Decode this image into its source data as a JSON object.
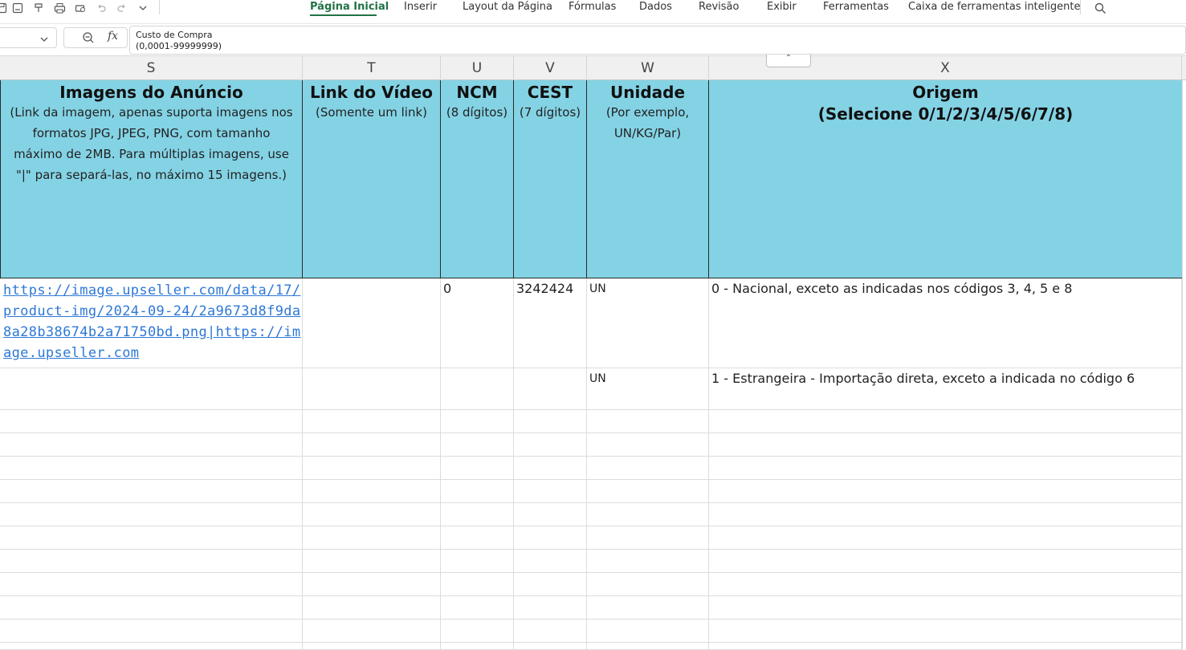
{
  "quick_access": {
    "icons": [
      "save-icon",
      "save-as-icon",
      "format-painter-icon",
      "print-icon",
      "print-preview-icon",
      "undo-icon",
      "redo-icon",
      "more-chevron-icon"
    ]
  },
  "menu": {
    "tabs": [
      {
        "label": "Página Inicial",
        "active": true
      },
      {
        "label": "Inserir"
      },
      {
        "label": "Layout da Página"
      },
      {
        "label": "Fórmulas"
      },
      {
        "label": "Dados"
      },
      {
        "label": "Revisão"
      },
      {
        "label": "Exibir"
      },
      {
        "label": "Ferramentas"
      },
      {
        "label": "Caixa de ferramentas inteligente"
      }
    ],
    "search_icon": "search-icon"
  },
  "formula_bar": {
    "name_box": "",
    "fx_label": "fx",
    "content_line1": "Custo de Compra",
    "content_line2": "(0,0001-99999999)"
  },
  "columns": [
    "S",
    "T",
    "U",
    "V",
    "W",
    "X"
  ],
  "headers": {
    "S": {
      "title": "Imagens do Anúncio",
      "sub": "(Link da imagem, apenas suporta imagens nos formatos JPG, JPEG, PNG, com tamanho máximo de 2MB. Para múltiplas imagens, use \"|\" para separá-las, no máximo 15 imagens.)"
    },
    "T": {
      "title": "Link do Vídeo",
      "sub": "(Somente um link)"
    },
    "U": {
      "title": "NCM",
      "sub": "(8 dígitos)"
    },
    "V": {
      "title": "CEST",
      "sub": "(7 dígitos)"
    },
    "W": {
      "title": "Unidade",
      "sub": "(Por exemplo, UN/KG/Par)"
    },
    "X": {
      "title": "Origem",
      "sub": "(Selecione 0/1/2/3/4/5/6/7/8)"
    }
  },
  "rows": [
    {
      "S": "https://image.upseller.com/data/17/product-img/2024-09-24/2a9673d8f9da8a28b38674b2a71750bd.png|https://image.upseller.com",
      "T": "",
      "U": "0",
      "V": "3242424",
      "W": "UN",
      "X": "0 - Nacional, exceto as indicadas nos códigos 3, 4, 5 e 8"
    },
    {
      "S": "",
      "T": "",
      "U": "",
      "V": "",
      "W": "UN",
      "X": "1 - Estrangeira - Importação direta, exceto a indicada no código 6"
    }
  ],
  "collapse_handle": "⌃"
}
